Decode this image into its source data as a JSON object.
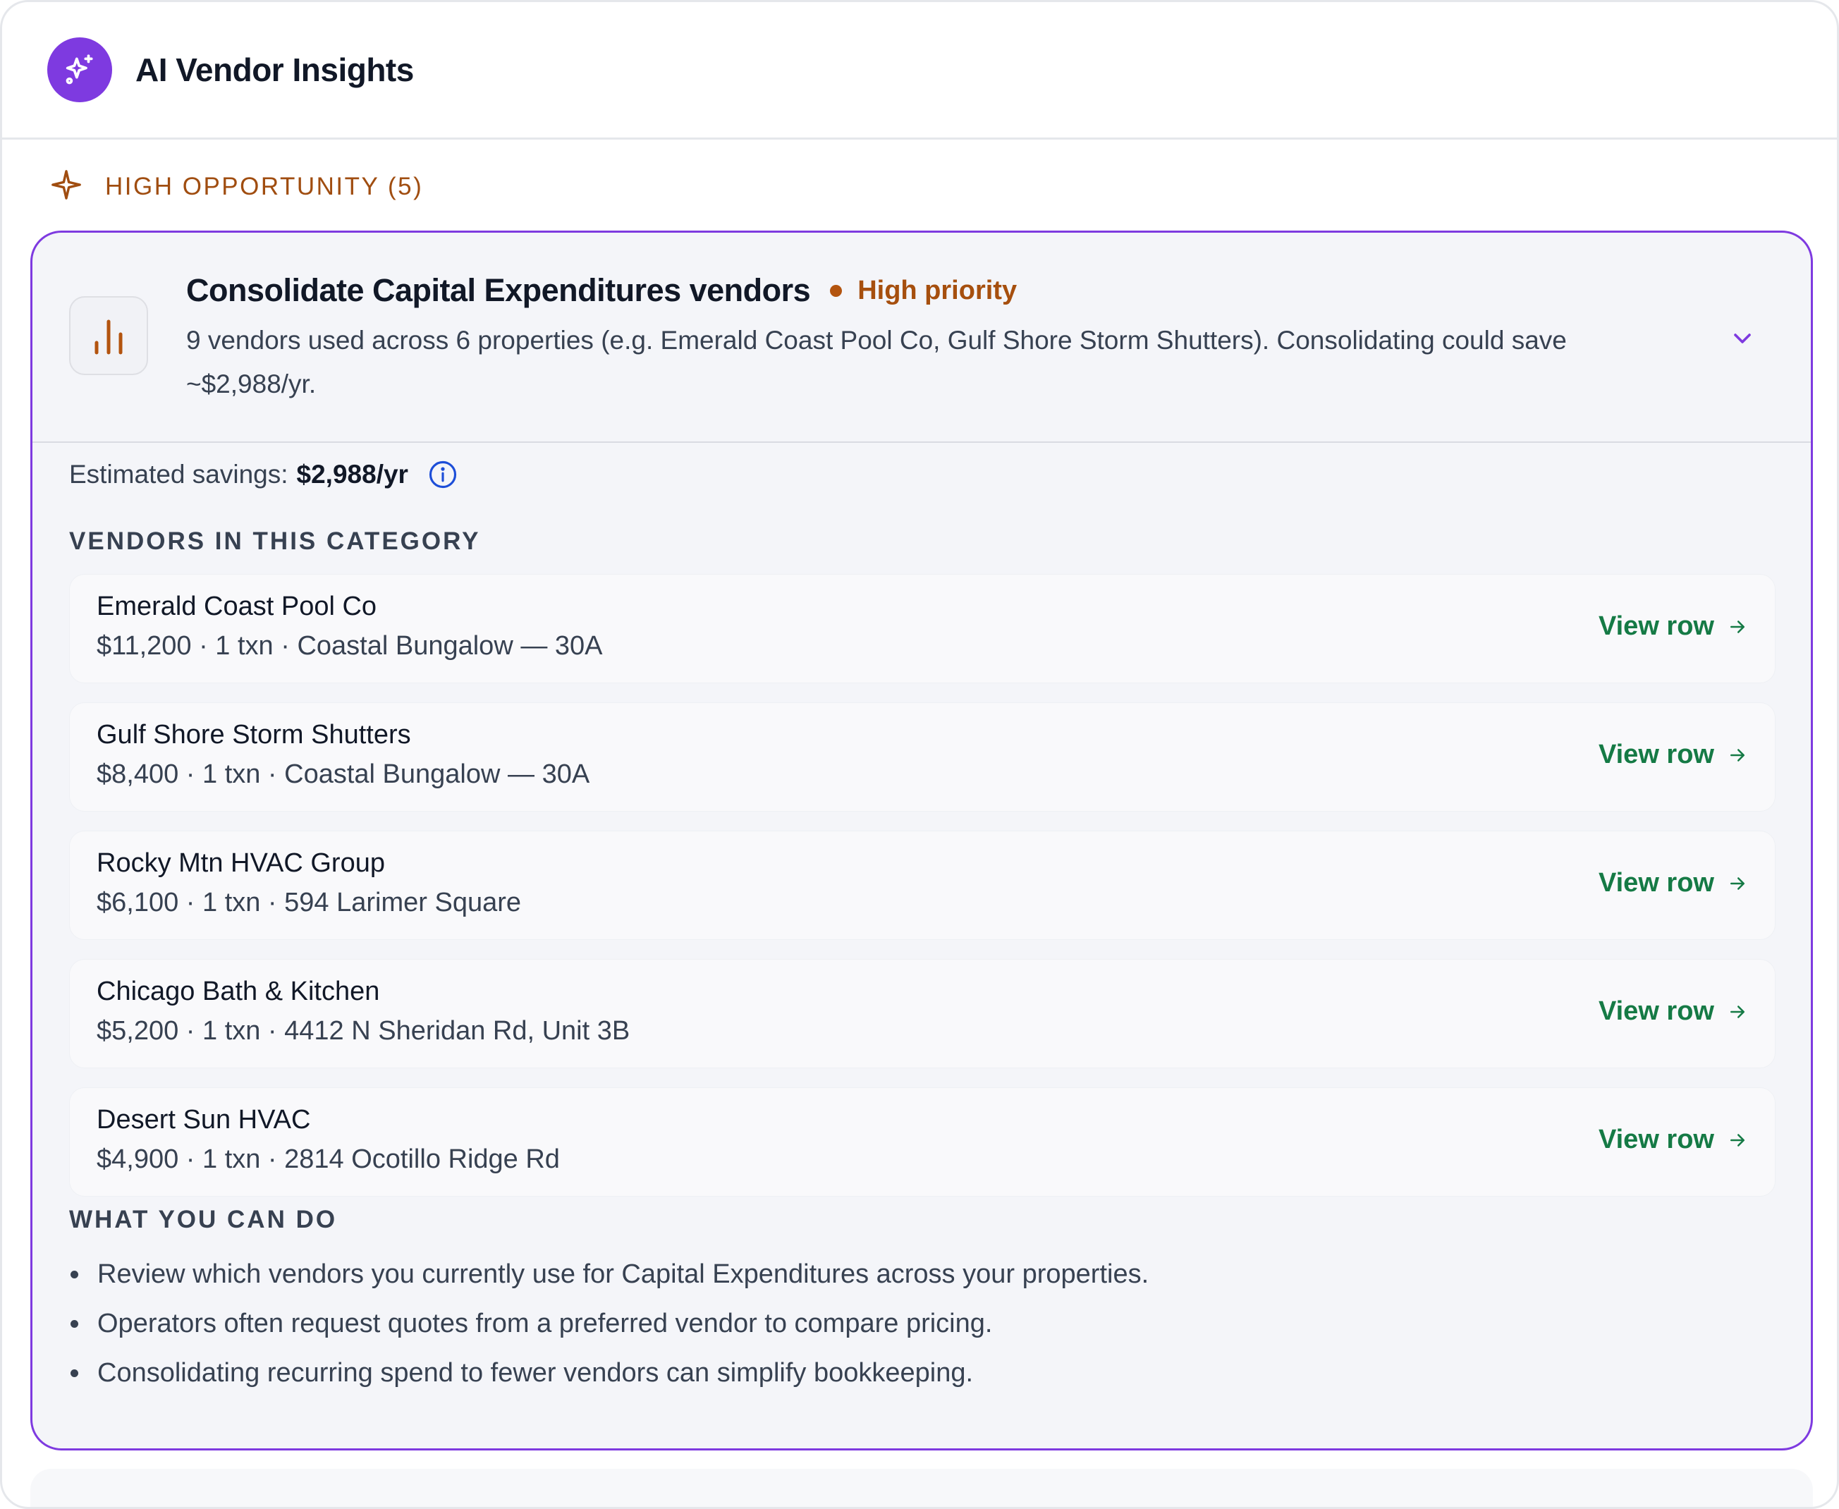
{
  "header": {
    "title": "AI Vendor Insights",
    "icon": "sparkles-icon",
    "accent": "#7e3ae0"
  },
  "section": {
    "label": "HIGH OPPORTUNITY (5)",
    "icon": "sparkle-icon",
    "color": "#a04d10"
  },
  "insight": {
    "title": "Consolidate Capital Expenditures vendors",
    "priority": "High priority",
    "priority_color": "#b3540f",
    "description": "9 vendors used across 6 properties (e.g. Emerald Coast Pool Co, Gulf Shore Storm Shutters). Consolidating could save ~$2,988/yr.",
    "savings_label": "Estimated savings:",
    "savings_value": "$2,988/yr",
    "vendors_heading": "VENDORS IN THIS CATEGORY",
    "vendors": [
      {
        "name": "Emerald Coast Pool Co",
        "meta": "$11,200 · 1 txn · Coastal Bungalow — 30A",
        "action": "View row"
      },
      {
        "name": "Gulf Shore Storm Shutters",
        "meta": "$8,400 · 1 txn · Coastal Bungalow — 30A",
        "action": "View row"
      },
      {
        "name": "Rocky Mtn HVAC Group",
        "meta": "$6,100 · 1 txn · 594 Larimer Square",
        "action": "View row"
      },
      {
        "name": "Chicago Bath & Kitchen",
        "meta": "$5,200 · 1 txn · 4412 N Sheridan Rd, Unit 3B",
        "action": "View row"
      },
      {
        "name": "Desert Sun HVAC",
        "meta": "$4,900 · 1 txn · 2814 Ocotillo Ridge Rd",
        "action": "View row"
      }
    ],
    "actions_heading": "WHAT YOU CAN DO",
    "tips": [
      "Review which vendors you currently use for Capital Expenditures across your properties.",
      "Operators often request quotes from a preferred vendor to compare pricing.",
      "Consolidating recurring spend to fewer vendors can simplify bookkeeping."
    ]
  }
}
